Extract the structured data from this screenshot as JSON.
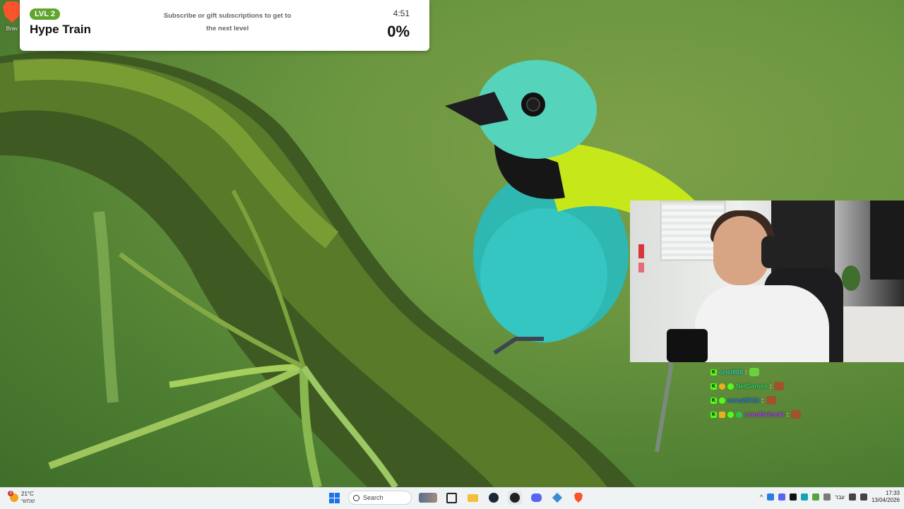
{
  "desktop": {
    "icon_label": "Brav"
  },
  "hype_train": {
    "level": "LVL 2",
    "title": "Hype Train",
    "subtitle_line1": "Subscribe or gift subscriptions to get to",
    "subtitle_line2": "the next level",
    "timer": "4:51",
    "progress_text": "0%",
    "progress": 0,
    "accent": "#5fa52d"
  },
  "chat": [
    {
      "user": "oriel888",
      "color": "#2fd0a8",
      "badges": [],
      "emote": "green-frog-emote"
    },
    {
      "user": "NetGamos",
      "color": "#2ed36a",
      "badges": [
        "gold-badge",
        "green-badge"
      ],
      "emote": "face-emote"
    },
    {
      "user": "nevo2911k",
      "color": "#2a7bd8",
      "badges": [
        "green-badge"
      ],
      "emote": "face-emote"
    },
    {
      "user": "LiamBaZooki",
      "color": "#b146f0",
      "badges": [
        "crown-badge",
        "green-badge",
        "clover-badge"
      ],
      "emote": "face-emote"
    }
  ],
  "chat_separator": ":",
  "taskbar": {
    "weather_temp": "21°C",
    "weather_desc": "שמשי",
    "weather_badge": "3",
    "search_label": "Search",
    "language": "עבר",
    "time": "17:33",
    "date": "13/04/2026"
  }
}
